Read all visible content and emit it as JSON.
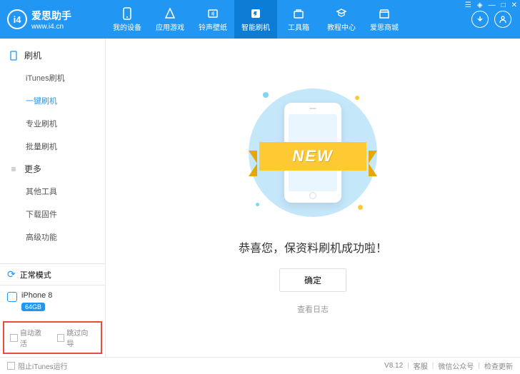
{
  "logo": {
    "badge": "i4",
    "name": "爱思助手",
    "url": "www.i4.cn"
  },
  "nav": [
    {
      "label": "我的设备"
    },
    {
      "label": "应用游戏"
    },
    {
      "label": "铃声壁纸"
    },
    {
      "label": "智能刷机"
    },
    {
      "label": "工具箱"
    },
    {
      "label": "教程中心"
    },
    {
      "label": "爱思商城"
    }
  ],
  "sidebar": {
    "group1": {
      "title": "刷机",
      "items": [
        "iTunes刷机",
        "一键刷机",
        "专业刷机",
        "批量刷机"
      ]
    },
    "group2": {
      "title": "更多",
      "items": [
        "其他工具",
        "下载固件",
        "高级功能"
      ]
    },
    "mode": "正常模式",
    "device": {
      "name": "iPhone 8",
      "storage": "64GB"
    },
    "checks": {
      "auto_activate": "自动激活",
      "skip_guide": "跳过向导"
    }
  },
  "main": {
    "new_badge": "NEW",
    "success": "恭喜您，保资料刷机成功啦！",
    "confirm": "确定",
    "log": "查看日志"
  },
  "footer": {
    "block_itunes": "阻止iTunes运行",
    "version": "V8.12",
    "support": "客服",
    "wechat": "微信公众号",
    "update": "检查更新"
  }
}
